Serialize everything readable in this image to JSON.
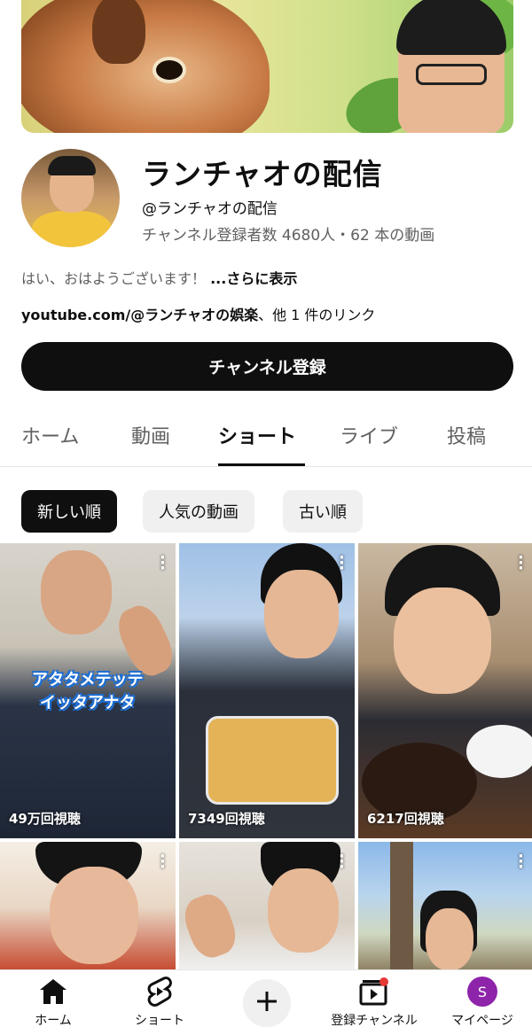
{
  "channel": {
    "name": "ランチャオの配信",
    "handle": "@ランチャオの配信",
    "stats": "チャンネル登録者数 4680人・62 本の動画",
    "description": "はい、おはようございます！ ",
    "description_more": "...さらに表示",
    "link_host": "youtube.com/@ランチャオの娯楽",
    "link_suffix": "、他 1 件のリンク",
    "subscribe_label": "チャンネル登録"
  },
  "tabs": [
    {
      "label": "ホーム"
    },
    {
      "label": "動画"
    },
    {
      "label": "ショート",
      "active": true
    },
    {
      "label": "ライブ"
    },
    {
      "label": "投稿"
    }
  ],
  "filters": [
    {
      "label": "新しい順",
      "selected": true
    },
    {
      "label": "人気の動画"
    },
    {
      "label": "古い順"
    }
  ],
  "shorts": [
    {
      "views": "49万回視聴",
      "overlay_lines": [
        "アタタメテッテ",
        "イッタアナタ"
      ]
    },
    {
      "views": "7349回視聴"
    },
    {
      "views": "6217回視聴"
    },
    {
      "views": ""
    },
    {
      "views": ""
    },
    {
      "views": ""
    }
  ],
  "bottom_nav": {
    "home": "ホーム",
    "shorts": "ショート",
    "subscriptions": "登録チャンネル",
    "mypage": "マイページ",
    "avatar_letter": "S"
  },
  "colors": {
    "primary_text": "#0f0f0f",
    "secondary_text": "#606060",
    "subscribe_bg": "#0f0f0f",
    "chip_bg": "#f0f0f0",
    "notification_dot": "#e53935",
    "avatar_bg": "#8e24aa"
  }
}
